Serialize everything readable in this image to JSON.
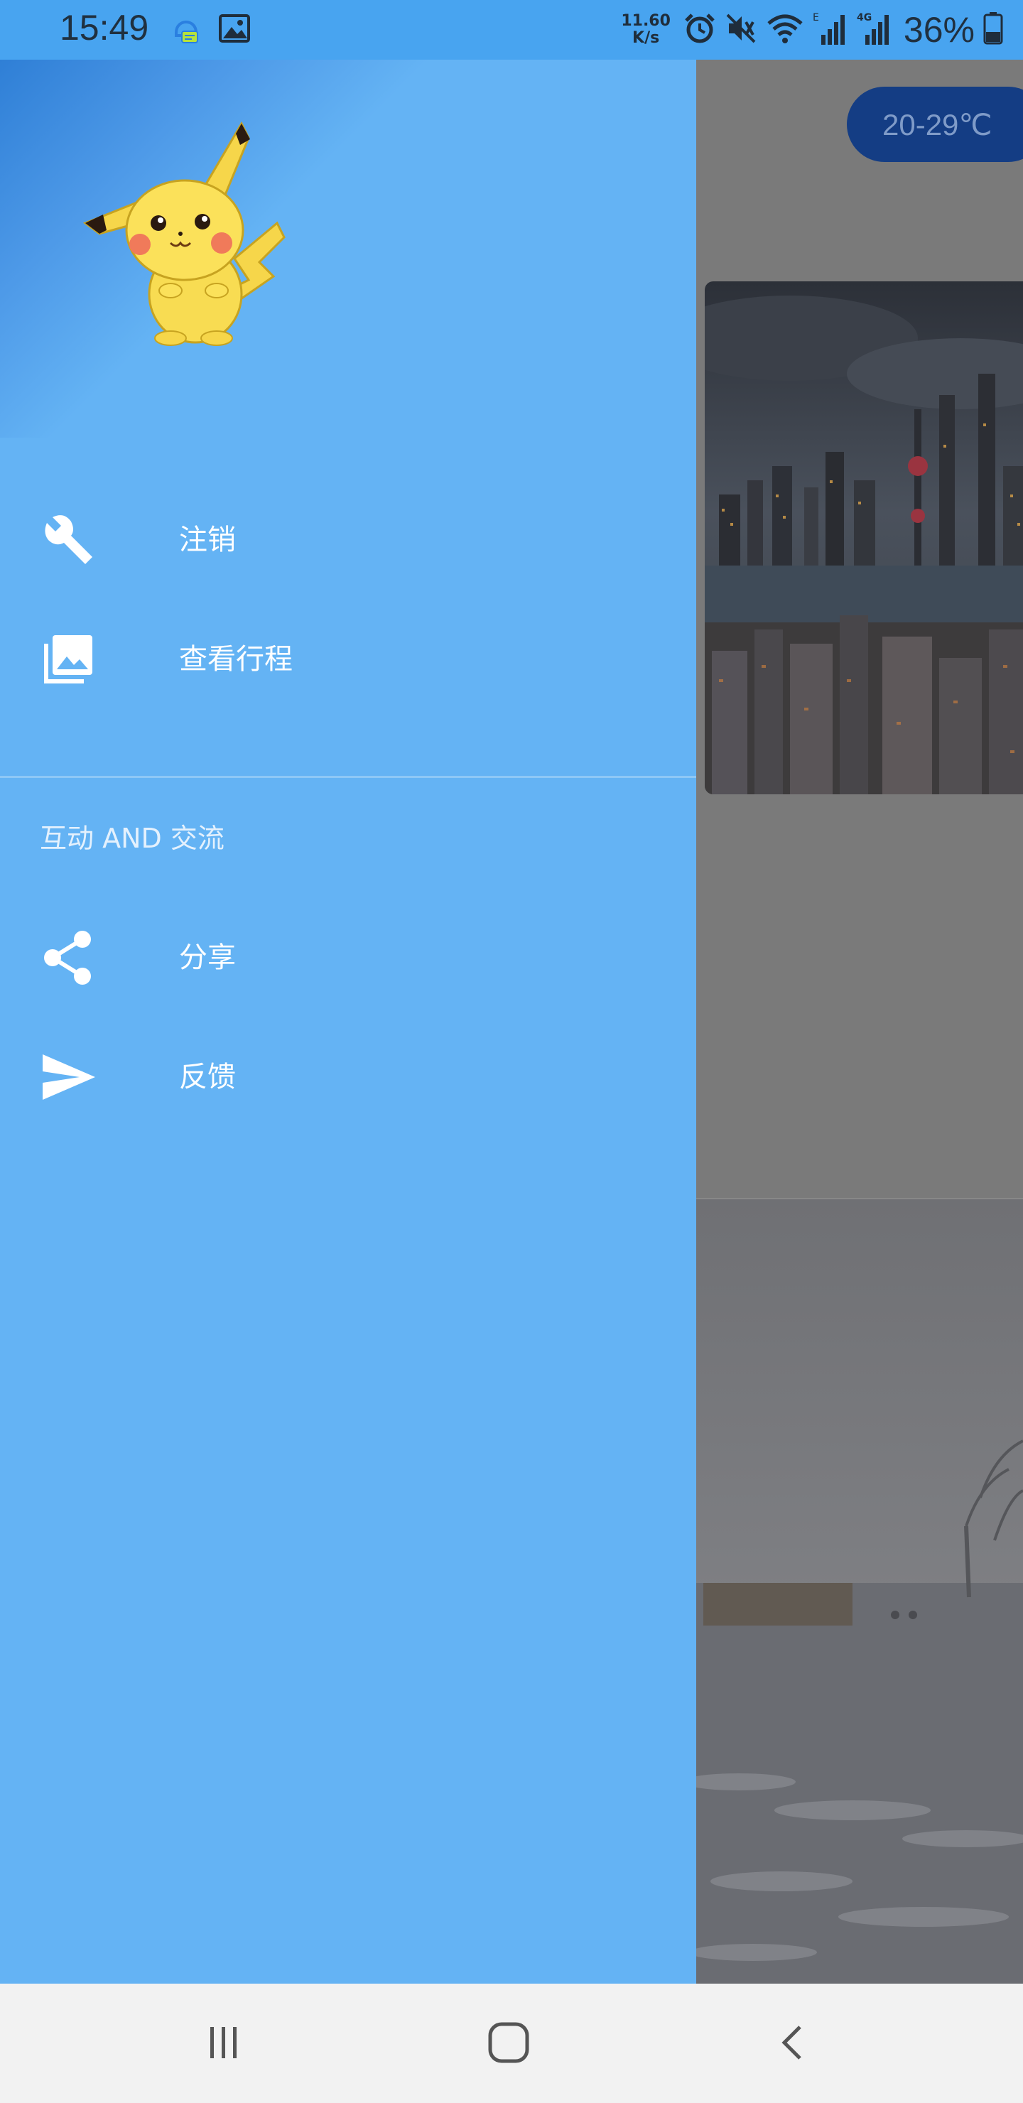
{
  "status_bar": {
    "time": "15:49",
    "net_speed_value": "11.60",
    "net_speed_unit": "K/s",
    "battery": "36%",
    "icons": [
      "notification-app-icon",
      "image-icon",
      "alarm-icon",
      "mute-icon",
      "wifi-icon",
      "signal-e-icon",
      "signal-4g-icon",
      "battery-icon"
    ]
  },
  "drawer": {
    "header_image": "pikachu-avatar",
    "items": [
      {
        "label": "注销",
        "icon": "wrench-icon"
      },
      {
        "label": "查看行程",
        "icon": "photo-library-icon"
      }
    ],
    "section_title": "互动 AND 交流",
    "section_items": [
      {
        "label": "分享",
        "icon": "share-icon"
      },
      {
        "label": "反馈",
        "icon": "send-icon"
      }
    ]
  },
  "main": {
    "temperature": "20-29℃"
  },
  "nav_bar": {
    "buttons": [
      "recents-button",
      "home-button",
      "back-button"
    ]
  },
  "colors": {
    "drawer_bg": "#64b3f4",
    "status_bar_bg": "#48a4f0",
    "temp_pill_bg": "#143d84",
    "nav_bar_bg": "#f2f2f2"
  }
}
